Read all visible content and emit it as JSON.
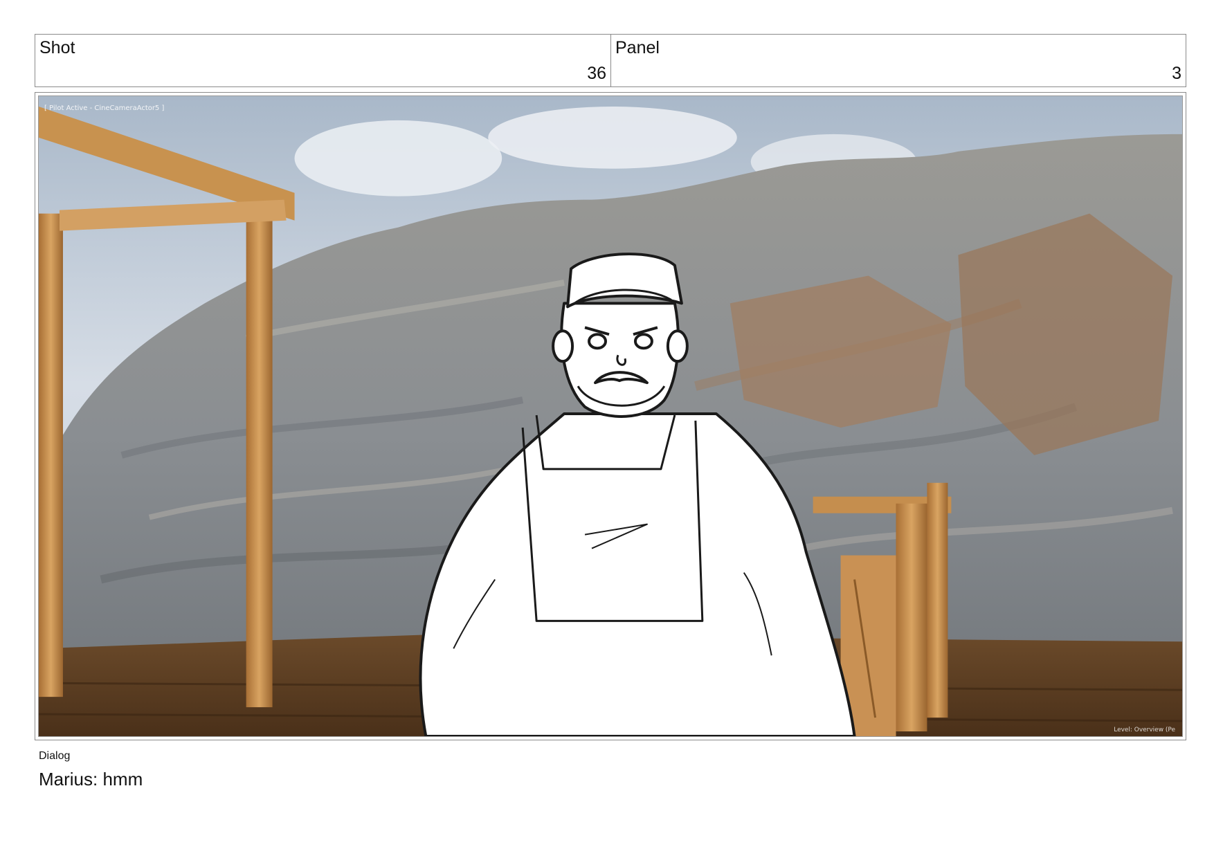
{
  "header": {
    "shot_label": "Shot",
    "shot_number": "36",
    "panel_label": "Panel",
    "panel_number": "3"
  },
  "panel_image": {
    "viewport_overlay_top": "[ Pilot Active - CineCameraActor5 ]",
    "viewport_overlay_bottom": "Level: Overview (Pe",
    "sky_color": "#c9d3de",
    "rock_color": "#8c8f93",
    "wood_color": "#c08a4c",
    "sketch_line_color": "#1a1a1a"
  },
  "dialog": {
    "label": "Dialog",
    "text": "Marius: hmm"
  }
}
